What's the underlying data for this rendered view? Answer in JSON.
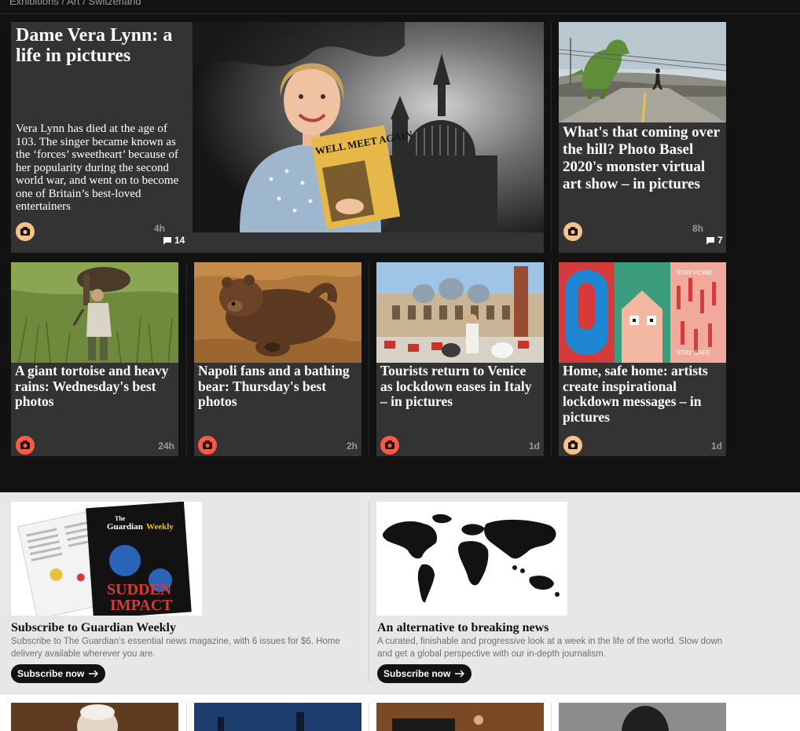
{
  "breadcrumb": "Exhibitions / Art / Switzerland",
  "featured": {
    "title": "Dame Vera Lynn: a life in pictures",
    "description": "Vera Lynn has died at the age of 103. The singer became known as the ‘forces’ sweetheart’ because of her popularity during the second world war, and went on to become one of Britain’s best-loved entertainers",
    "age": "4h",
    "comments": "14",
    "photo_text": "WELL MEET AGAIN",
    "icon": "camera-icon",
    "icon_color": "#f5c28a"
  },
  "side_card": {
    "title": "What's that coming over the hill? Photo Basel 2020's monster virtual art show – in pictures",
    "age": "8h",
    "comments": "7",
    "icon": "camera-icon",
    "icon_color": "#f5c28a"
  },
  "cards": [
    {
      "title": "A giant tortoise and heavy rains: Wednesday's best photos",
      "age": "24h",
      "icon": "camera-icon",
      "icon_color": "#ff5943"
    },
    {
      "title": "Napoli fans and a bathing bear: Thursday's best photos",
      "age": "2h",
      "icon": "camera-icon",
      "icon_color": "#ff5943"
    },
    {
      "title": "Tourists return to Venice as lockdown eases in Italy – in pictures",
      "age": "1d",
      "icon": "camera-icon",
      "icon_color": "#ff5943"
    },
    {
      "title": "Home, safe home: artists create inspirational lockdown messages – in pictures",
      "age": "1d",
      "icon": "camera-icon",
      "icon_color": "#f5c28a",
      "poster_text_1": "STAY HOME",
      "poster_text_2": "STAY SAFE"
    }
  ],
  "promos": [
    {
      "title": "Subscribe to Guardian Weekly",
      "description": "Subscribe to The Guardian's essential news magazine, with 6 issues for $6. Home delivery available wherever you are.",
      "button": "Subscribe now",
      "magazine_masthead_1": "The",
      "magazine_masthead_2": "Guardian",
      "magazine_masthead_3": "Weekly",
      "magazine_headline_1": "SUDDEN",
      "magazine_headline_2": "IMPACT"
    },
    {
      "title": "An alternative to breaking news",
      "description": "A curated, finishable and progressive look at a week in the life of the world. Slow down and get a global perspective with our in-depth journalism.",
      "button": "Subscribe now"
    }
  ],
  "colors": {
    "background": "#121212",
    "card": "#333333",
    "promo_background": "#e7e7e7",
    "accent_red": "#ff5943",
    "accent_tan": "#f5c28a"
  }
}
